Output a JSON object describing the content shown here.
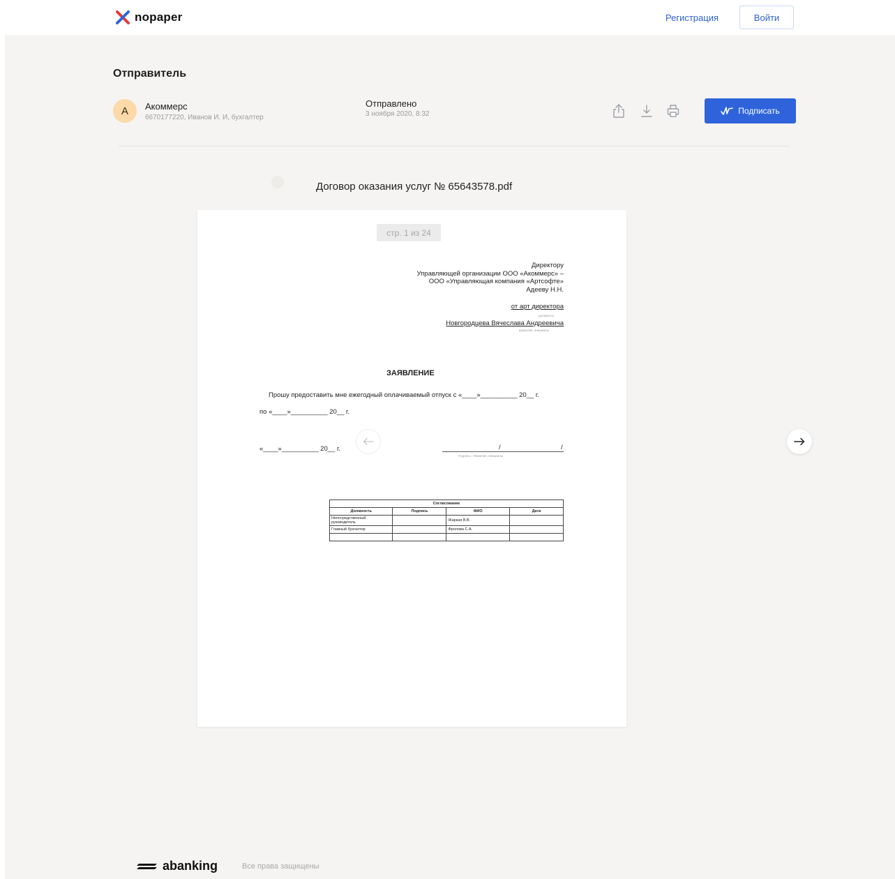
{
  "header": {
    "logo_text": "nopaper",
    "register_label": "Регистрация",
    "login_label": "Войти"
  },
  "sender": {
    "heading": "Отправитель",
    "avatar_initial": "А",
    "name": "Акоммерс",
    "details": "6670177220, Иванов И. И, бухгалтер",
    "sent_label": "Отправлено",
    "sent_date": "3 ноября 2020, 8:32"
  },
  "actions": {
    "sign_label": "Подписать",
    "share_icon": "share-icon",
    "download_icon": "download-icon",
    "print_icon": "print-icon"
  },
  "document": {
    "title": "Договор оказания услуг № 65643578.pdf",
    "page_indicator": "стр. 1 из 24",
    "addressee_lines": [
      "Директору",
      "Управляющей организации ООО «Акоммерс» –",
      "ООО «Управляющая компания «Артсофте»",
      "Адееву Н.Н."
    ],
    "from_line": "от арт директора",
    "from_caption": "должность",
    "from_name": "Новгородцева Вячеслава Андреевича",
    "from_name_caption": "фамилия, инициалы",
    "statement_heading": "ЗАЯВЛЕНИЕ",
    "statement_line1": "Прошу предоставить мне ежегодный оплачиваемый отпуск с «____»__________ 20__ г.",
    "statement_line2": "по «____»__________ 20__ г.",
    "date_line": "«____»__________ 20__ г.",
    "signature_caption": "Подпись     /     Фамилия, инициалы",
    "table": {
      "title": "Согласование",
      "headers": [
        "Должность",
        "Подпись",
        "ФИО",
        "Дата"
      ],
      "rows": [
        [
          "Непосредственный руководитель",
          "",
          "Жаркая В.В.",
          ""
        ],
        [
          "Главный бухгалтер",
          "",
          "Фролова С.А.",
          ""
        ],
        [
          "",
          "",
          "",
          ""
        ]
      ]
    }
  },
  "footer": {
    "logo_text": "abanking",
    "rights": "Все права защищены"
  },
  "colors": {
    "accent": "#2e63db",
    "background": "#f6f4f2",
    "avatar_bg": "#fcd9a8",
    "logo_red": "#e53935",
    "logo_blue": "#2e63db"
  }
}
